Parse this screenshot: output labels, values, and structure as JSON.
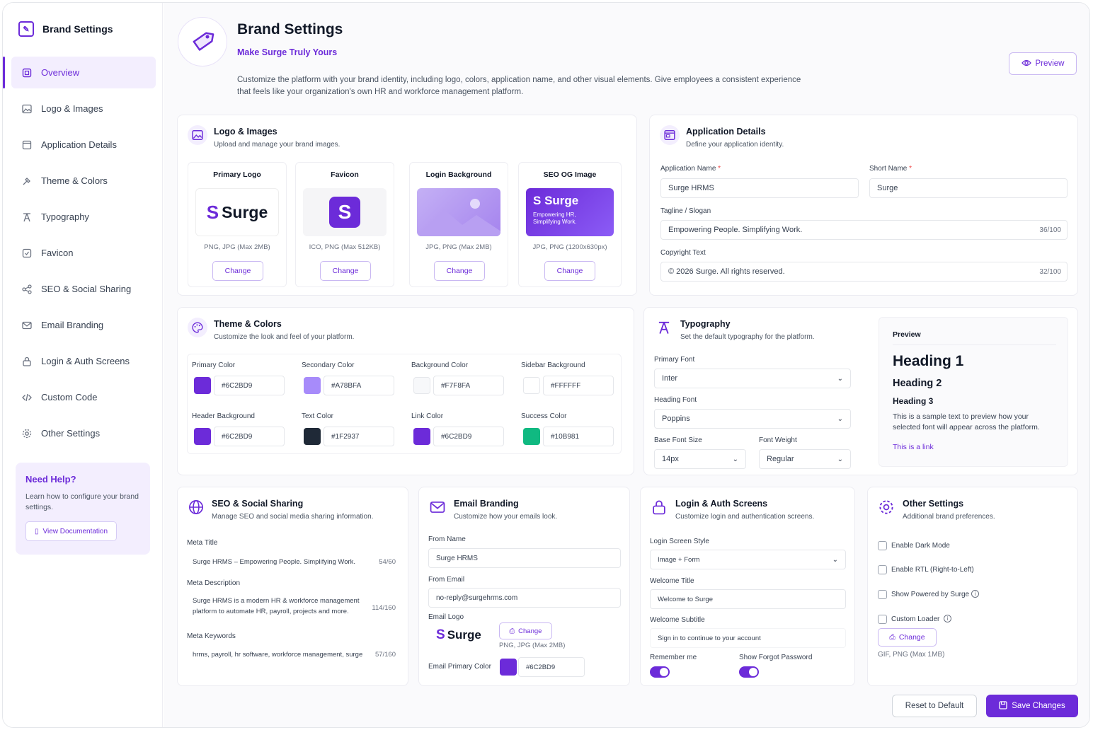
{
  "sidebar": {
    "title": "Brand Settings",
    "items": [
      {
        "label": "Overview",
        "icon": "overview-icon"
      },
      {
        "label": "Logo & Images",
        "icon": "image-icon"
      },
      {
        "label": "Application Details",
        "icon": "app-details-icon"
      },
      {
        "label": "Theme & Colors",
        "icon": "brush-icon"
      },
      {
        "label": "Typography",
        "icon": "typography-icon"
      },
      {
        "label": "Favicon",
        "icon": "favicon-icon"
      },
      {
        "label": "SEO & Social Sharing",
        "icon": "share-icon"
      },
      {
        "label": "Email Branding",
        "icon": "mail-icon"
      },
      {
        "label": "Login & Auth Screens",
        "icon": "lock-icon"
      },
      {
        "label": "Custom Code",
        "icon": "code-icon"
      },
      {
        "label": "Other Settings",
        "icon": "gear-icon"
      }
    ],
    "help": {
      "title": "Need Help?",
      "text": "Learn how to configure your brand settings.",
      "button": "View Documentation"
    }
  },
  "header": {
    "title": "Brand Settings",
    "subtitle": "Make Surge Truly Yours",
    "description": "Customize the platform with your brand identity, including logo, colors, application name, and other visual elements. Give employees a consistent experience that feels like your organization's own HR and workforce management platform.",
    "preview_button": "Preview"
  },
  "logo_images": {
    "title": "Logo & Images",
    "subtitle": "Upload and manage your brand images.",
    "items": [
      {
        "title": "Primary Logo",
        "format": "PNG, JPG (Max 2MB)",
        "button": "Change",
        "logo_text": "Surge"
      },
      {
        "title": "Favicon",
        "format": "ICO, PNG (Max 512KB)",
        "button": "Change",
        "logo_text": "S"
      },
      {
        "title": "Login Background",
        "format": "JPG, PNG (Max 2MB)",
        "button": "Change"
      },
      {
        "title": "SEO OG Image",
        "format": "JPG, PNG (1200x630px)",
        "button": "Change",
        "logo_text": "Surge",
        "tagline": "Empowering HR, Simplifying Work."
      }
    ]
  },
  "app_details": {
    "title": "Application Details",
    "subtitle": "Define your application identity.",
    "app_name_label": "Application Name",
    "app_name": "Surge HRMS",
    "short_name_label": "Short Name",
    "short_name": "Surge",
    "required_mark": "*",
    "tagline_label": "Tagline / Slogan",
    "tagline": "Empowering People. Simplifying Work.",
    "tagline_count": "36/100",
    "copyright_label": "Copyright Text",
    "copyright": "© 2026 Surge. All rights reserved.",
    "copyright_count": "32/100"
  },
  "theme": {
    "title": "Theme & Colors",
    "subtitle": "Customize the look and feel of your platform.",
    "colors": [
      {
        "label": "Primary Color",
        "hex": "#6C2BD9"
      },
      {
        "label": "Secondary Color",
        "hex": "#A78BFA"
      },
      {
        "label": "Background Color",
        "hex": "#F7F8FA"
      },
      {
        "label": "Sidebar Background",
        "hex": "#FFFFFF"
      },
      {
        "label": "Header Background",
        "hex": "#6C2BD9"
      },
      {
        "label": "Text Color",
        "hex": "#1F2937"
      },
      {
        "label": "Link Color",
        "hex": "#6C2BD9"
      },
      {
        "label": "Success Color",
        "hex": "#10B981"
      }
    ]
  },
  "typography": {
    "title": "Typography",
    "subtitle": "Set the default typography for the platform.",
    "primary_font_label": "Primary Font",
    "primary_font": "Inter",
    "heading_font_label": "Heading Font",
    "heading_font": "Poppins",
    "base_size_label": "Base Font Size",
    "base_size": "14px",
    "weight_label": "Font Weight",
    "weight": "Regular",
    "preview": {
      "label": "Preview",
      "h1": "Heading 1",
      "h2": "Heading 2",
      "h3": "Heading 3",
      "text": "This is a sample text to preview how your selected font will appear across the platform.",
      "link": "This is a link"
    }
  },
  "seo": {
    "title": "SEO & Social Sharing",
    "subtitle": "Manage SEO and social media sharing information.",
    "meta_title_label": "Meta Title",
    "meta_title": "Surge HRMS – Empowering People. Simplifying Work.",
    "meta_title_count": "54/60",
    "meta_desc_label": "Meta Description",
    "meta_desc": "Surge HRMS is a modern HR & workforce management platform to automate HR, payroll, projects and more.",
    "meta_desc_count": "114/160",
    "meta_keywords_label": "Meta Keywords",
    "meta_keywords": "hrms, payroll, hr software, workforce management, surge",
    "meta_keywords_count": "57/160"
  },
  "email": {
    "title": "Email Branding",
    "subtitle": "Customize how your emails look.",
    "from_name_label": "From Name",
    "from_name": "Surge HRMS",
    "from_email_label": "From Email",
    "from_email": "no-reply@surgehrms.com",
    "logo_label": "Email Logo",
    "logo_text": "Surge",
    "change_button": "Change",
    "logo_format": "PNG, JPG (Max 2MB)",
    "primary_color_label": "Email Primary Color",
    "primary_color": "#6C2BD9"
  },
  "login": {
    "title": "Login & Auth Screens",
    "subtitle": "Customize login and authentication screens.",
    "style_label": "Login Screen Style",
    "style": "Image + Form",
    "welcome_title_label": "Welcome Title",
    "welcome_title": "Welcome to Surge",
    "welcome_subtitle_label": "Welcome Subtitle",
    "welcome_subtitle": "Sign in to continue to your account",
    "remember_label": "Remember me",
    "forgot_label": "Show Forgot Password",
    "remember_on": true,
    "forgot_on": true
  },
  "other": {
    "title": "Other Settings",
    "subtitle": "Additional brand preferences.",
    "options": [
      "Enable Dark Mode",
      "Enable RTL (Right-to-Left)",
      "Show Powered by Surge",
      "Custom Loader"
    ],
    "change_button": "Change",
    "loader_format": "GIF, PNG (Max 1MB)"
  },
  "footer": {
    "reset": "Reset to Default",
    "save": "Save Changes"
  },
  "accent_color": "#6C2BD9"
}
